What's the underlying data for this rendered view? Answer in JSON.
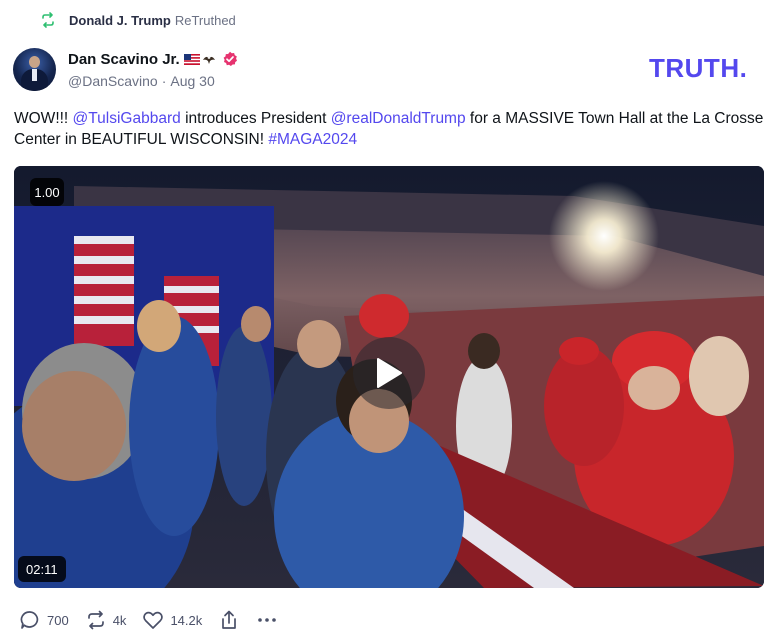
{
  "retruth": {
    "icon": "retruth-icon",
    "name": "Donald J. Trump",
    "suffix": "ReTruthed",
    "accent": "#2fbf71"
  },
  "author": {
    "display_name": "Dan Scavino Jr.",
    "badges": [
      "us-flag-icon",
      "eagle-icon",
      "verified-badge-icon"
    ],
    "handle": "@DanScavino",
    "separator": "·",
    "date": "Aug 30"
  },
  "logo": {
    "text": "TRUTH.",
    "color": "#5448ee"
  },
  "post": {
    "segments": [
      {
        "type": "text",
        "value": "WOW!!! "
      },
      {
        "type": "mention",
        "value": "@TulsiGabbard"
      },
      {
        "type": "text",
        "value": " introduces President "
      },
      {
        "type": "mention",
        "value": "@realDonaldTrump"
      },
      {
        "type": "text",
        "value": " for a MASSIVE Town Hall at the La Crosse Center in BEAUTIFUL WISCONSIN! "
      },
      {
        "type": "hashtag",
        "value": "#MAGA2024"
      }
    ],
    "link_color": "#5448ee"
  },
  "video": {
    "speed": "1.00",
    "duration": "02:11",
    "play_icon": "play-icon"
  },
  "actions": {
    "reply": {
      "icon": "reply-icon",
      "count": "700"
    },
    "retruth": {
      "icon": "retruth-icon",
      "count": "4k"
    },
    "like": {
      "icon": "heart-icon",
      "count": "14.2k"
    },
    "share": {
      "icon": "share-icon"
    },
    "more": {
      "icon": "more-icon"
    }
  }
}
